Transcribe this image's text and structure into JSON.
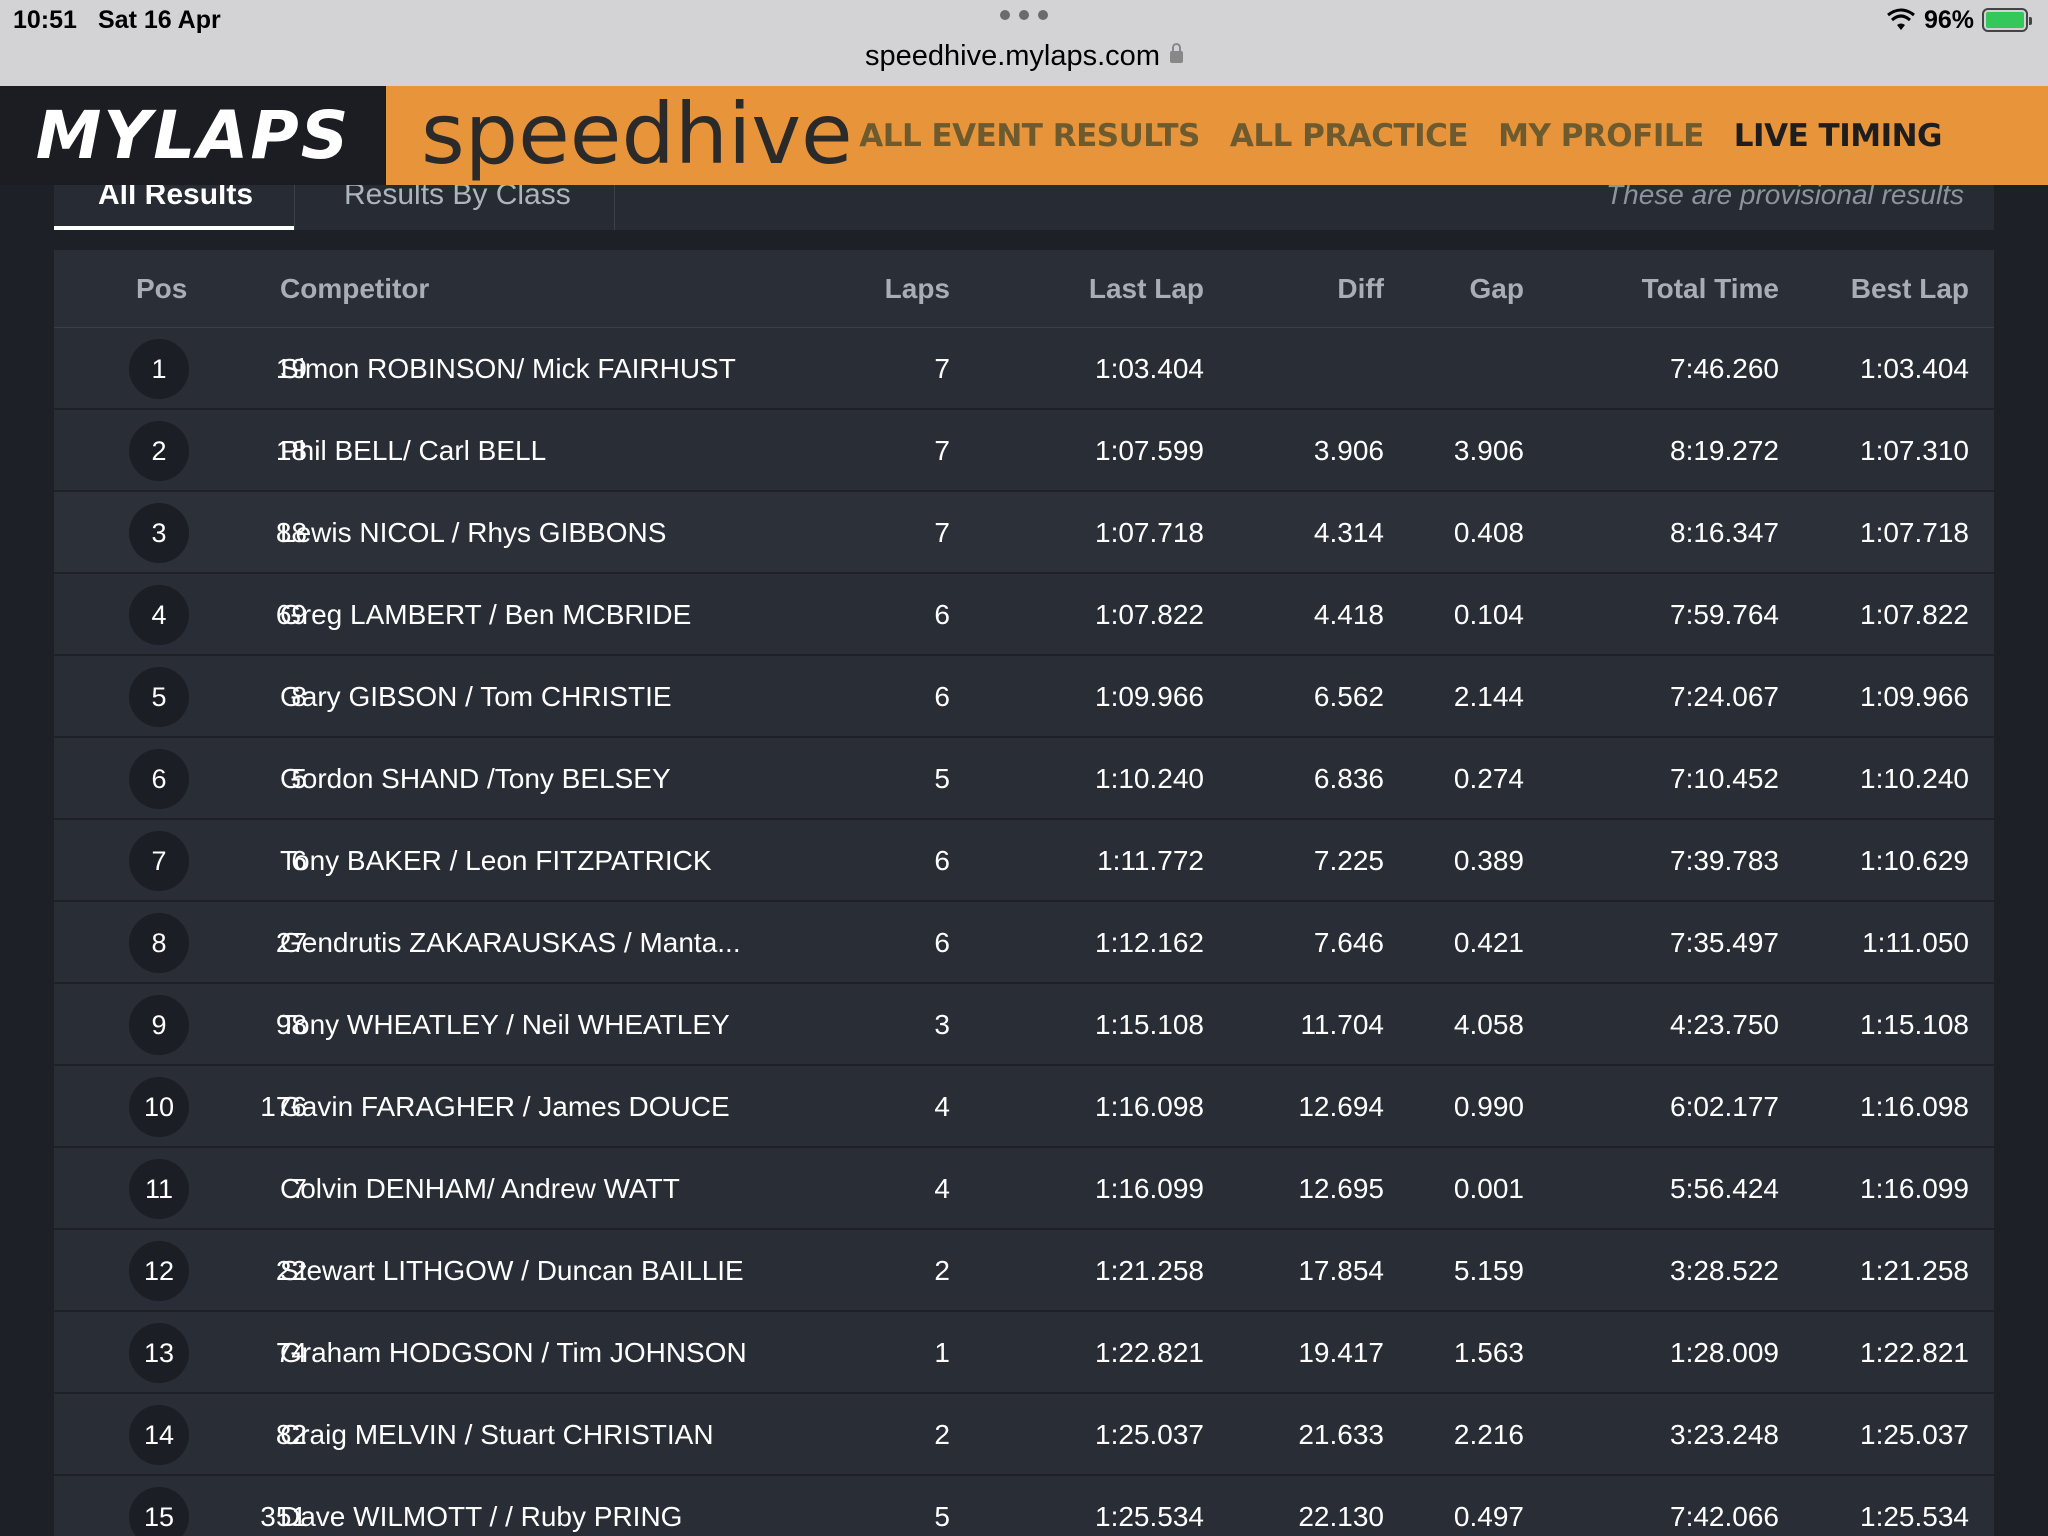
{
  "status_bar": {
    "time": "10:51",
    "date": "Sat 16 Apr",
    "battery": "96%",
    "battery_icon": "battery-charging-icon",
    "wifi_icon": "wifi-icon"
  },
  "browser": {
    "url": "speedhive.mylaps.com",
    "lock_icon": "lock-icon"
  },
  "header": {
    "logo": "MYLAPS",
    "brand": "speedhive",
    "nav": [
      "ALL EVENT RESULTS",
      "ALL PRACTICE",
      "MY PROFILE",
      "LIVE TIMING"
    ],
    "active_nav": "LIVE TIMING"
  },
  "tabs": {
    "all_results": "All Results",
    "results_by_class": "Results By Class",
    "provisional_note": "These are provisional results"
  },
  "table": {
    "columns": {
      "pos": "Pos",
      "competitor": "Competitor",
      "laps": "Laps",
      "last_lap": "Last Lap",
      "diff": "Diff",
      "gap": "Gap",
      "total_time": "Total Time",
      "best_lap": "Best Lap"
    },
    "rows": [
      {
        "pos": "1",
        "num": "19",
        "name": "Simon ROBINSON/ Mick FAIRHUST",
        "laps": "7",
        "last": "1:03.404",
        "diff": "",
        "gap": "",
        "total": "7:46.260",
        "best": "1:03.404"
      },
      {
        "pos": "2",
        "num": "18",
        "name": "Phil BELL/ Carl BELL",
        "laps": "7",
        "last": "1:07.599",
        "diff": "3.906",
        "gap": "3.906",
        "total": "8:19.272",
        "best": "1:07.310"
      },
      {
        "pos": "3",
        "num": "88",
        "name": "Lewis NICOL / Rhys GIBBONS",
        "laps": "7",
        "last": "1:07.718",
        "diff": "4.314",
        "gap": "0.408",
        "total": "8:16.347",
        "best": "1:07.718"
      },
      {
        "pos": "4",
        "num": "69",
        "name": "Greg LAMBERT / Ben MCBRIDE",
        "laps": "6",
        "last": "1:07.822",
        "diff": "4.418",
        "gap": "0.104",
        "total": "7:59.764",
        "best": "1:07.822"
      },
      {
        "pos": "5",
        "num": "8",
        "name": "Gary GIBSON / Tom CHRISTIE",
        "laps": "6",
        "last": "1:09.966",
        "diff": "6.562",
        "gap": "2.144",
        "total": "7:24.067",
        "best": "1:09.966"
      },
      {
        "pos": "6",
        "num": "5",
        "name": "Gordon SHAND /Tony BELSEY",
        "laps": "5",
        "last": "1:10.240",
        "diff": "6.836",
        "gap": "0.274",
        "total": "7:10.452",
        "best": "1:10.240"
      },
      {
        "pos": "7",
        "num": "6",
        "name": "Tony BAKER / Leon FITZPATRICK",
        "laps": "6",
        "last": "1:11.772",
        "diff": "7.225",
        "gap": "0.389",
        "total": "7:39.783",
        "best": "1:10.629"
      },
      {
        "pos": "8",
        "num": "27",
        "name": "Gendrutis ZAKARAUSKAS / Manta...",
        "laps": "6",
        "last": "1:12.162",
        "diff": "7.646",
        "gap": "0.421",
        "total": "7:35.497",
        "best": "1:11.050"
      },
      {
        "pos": "9",
        "num": "98",
        "name": "Tony WHEATLEY / Neil WHEATLEY",
        "laps": "3",
        "last": "1:15.108",
        "diff": "11.704",
        "gap": "4.058",
        "total": "4:23.750",
        "best": "1:15.108"
      },
      {
        "pos": "10",
        "num": "176",
        "name": "Gavin FARAGHER / James DOUCE",
        "laps": "4",
        "last": "1:16.098",
        "diff": "12.694",
        "gap": "0.990",
        "total": "6:02.177",
        "best": "1:16.098"
      },
      {
        "pos": "11",
        "num": "7",
        "name": "Colvin DENHAM/ Andrew WATT",
        "laps": "4",
        "last": "1:16.099",
        "diff": "12.695",
        "gap": "0.001",
        "total": "5:56.424",
        "best": "1:16.099"
      },
      {
        "pos": "12",
        "num": "22",
        "name": "Stewart LITHGOW / Duncan BAILLIE",
        "laps": "2",
        "last": "1:21.258",
        "diff": "17.854",
        "gap": "5.159",
        "total": "3:28.522",
        "best": "1:21.258"
      },
      {
        "pos": "13",
        "num": "74",
        "name": "Graham HODGSON / Tim JOHNSON",
        "laps": "1",
        "last": "1:22.821",
        "diff": "19.417",
        "gap": "1.563",
        "total": "1:28.009",
        "best": "1:22.821"
      },
      {
        "pos": "14",
        "num": "82",
        "name": "Craig MELVIN / Stuart CHRISTIAN",
        "laps": "2",
        "last": "1:25.037",
        "diff": "21.633",
        "gap": "2.216",
        "total": "3:23.248",
        "best": "1:25.037"
      },
      {
        "pos": "15",
        "num": "351",
        "name": "Dave WILMOTT / / Ruby PRING",
        "laps": "5",
        "last": "1:25.534",
        "diff": "22.130",
        "gap": "0.497",
        "total": "7:42.066",
        "best": "1:25.534"
      }
    ]
  },
  "colors": {
    "accent_orange": "#e8943a",
    "logo_bg": "#1b1d22",
    "table_bg": "#292d35",
    "page_bg": "#1d2027"
  }
}
